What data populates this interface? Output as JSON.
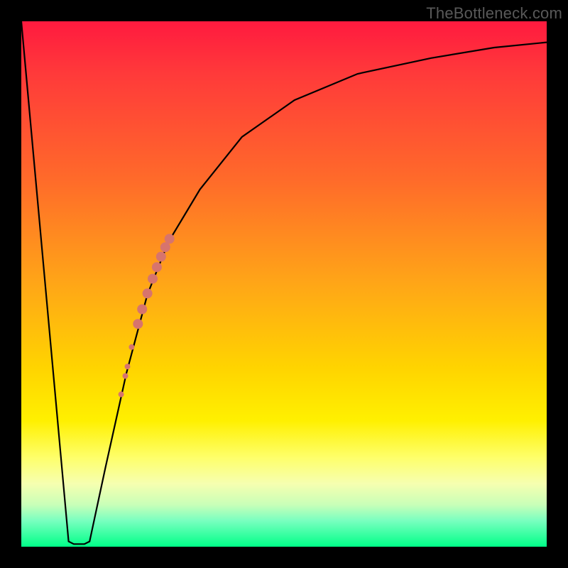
{
  "watermark": {
    "text": "TheBottleneck.com"
  },
  "chart_data": {
    "type": "line",
    "title": "",
    "xlabel": "",
    "ylabel": "",
    "xlim": [
      0,
      100
    ],
    "ylim": [
      0,
      100
    ],
    "grid": false,
    "series": [
      {
        "name": "bottleneck-curve",
        "x": [
          0,
          9,
          10,
          12,
          13,
          16,
          20,
          24,
          28,
          34,
          42,
          52,
          64,
          78,
          90,
          100
        ],
        "values": [
          100,
          1,
          0.5,
          0.5,
          1,
          15,
          33,
          48,
          58,
          68,
          78,
          85,
          90,
          93,
          95,
          96
        ]
      }
    ],
    "markers": [
      {
        "x": 19.0,
        "y": 29.0,
        "r": 4
      },
      {
        "x": 19.8,
        "y": 32.5,
        "r": 4
      },
      {
        "x": 20.2,
        "y": 34.3,
        "r": 4
      },
      {
        "x": 21.0,
        "y": 38.0,
        "r": 4
      },
      {
        "x": 22.2,
        "y": 42.4,
        "r": 7
      },
      {
        "x": 23.0,
        "y": 45.2,
        "r": 7
      },
      {
        "x": 24.0,
        "y": 48.2,
        "r": 7
      },
      {
        "x": 25.0,
        "y": 51.0,
        "r": 7
      },
      {
        "x": 25.8,
        "y": 53.2,
        "r": 7
      },
      {
        "x": 26.6,
        "y": 55.2,
        "r": 7
      },
      {
        "x": 27.4,
        "y": 57.0,
        "r": 7
      },
      {
        "x": 28.2,
        "y": 58.6,
        "r": 7
      }
    ],
    "background": {
      "type": "vertical-gradient",
      "stops": [
        {
          "pos": 0.0,
          "color": "#ff1a3f"
        },
        {
          "pos": 0.3,
          "color": "#ff6a2a"
        },
        {
          "pos": 0.66,
          "color": "#ffd400"
        },
        {
          "pos": 0.83,
          "color": "#feff6a"
        },
        {
          "pos": 0.92,
          "color": "#c9ffb8"
        },
        {
          "pos": 1.0,
          "color": "#00ff88"
        }
      ]
    }
  }
}
